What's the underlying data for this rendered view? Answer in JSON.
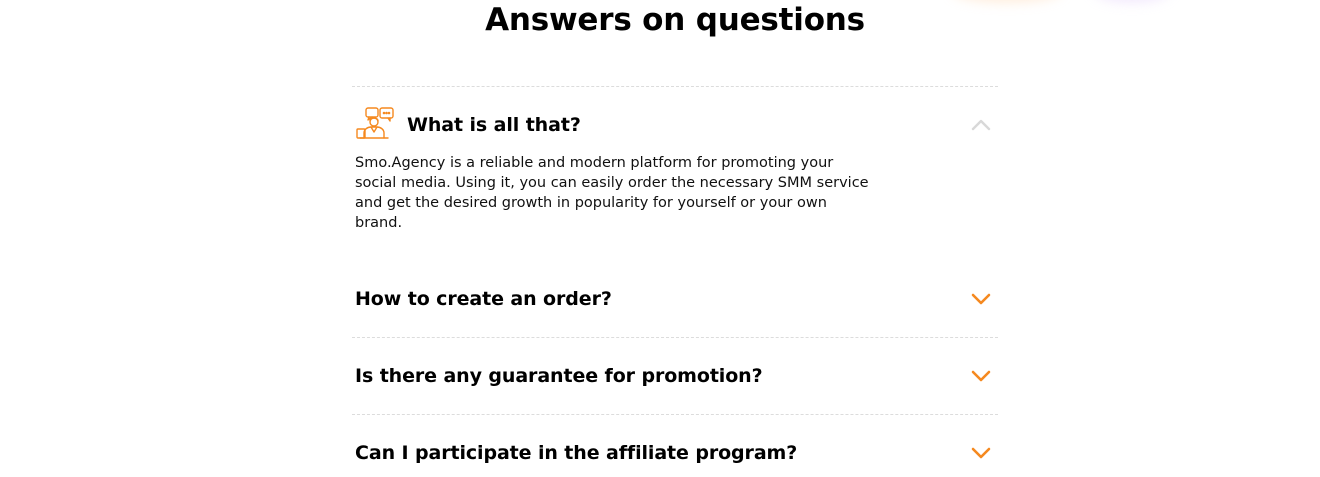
{
  "section": {
    "title": "Answers on questions"
  },
  "colors": {
    "accent": "#f5891f",
    "chevron_open": "#d8d8d8",
    "divider": "#dcdcdc"
  },
  "faq": {
    "items": [
      {
        "question": "What is all that?",
        "answer": "Smo.Agency is a reliable and modern platform for promoting your social media. Using it, you can easily order the necessary SMM service and get the desired growth in popularity for yourself or your own brand.",
        "icon": "support-chat-icon",
        "expanded": true
      },
      {
        "question": "How to create an order?",
        "expanded": false
      },
      {
        "question": "Is there any guarantee for promotion?",
        "expanded": false
      },
      {
        "question": "Can I participate in the affiliate program?",
        "expanded": false
      }
    ]
  }
}
